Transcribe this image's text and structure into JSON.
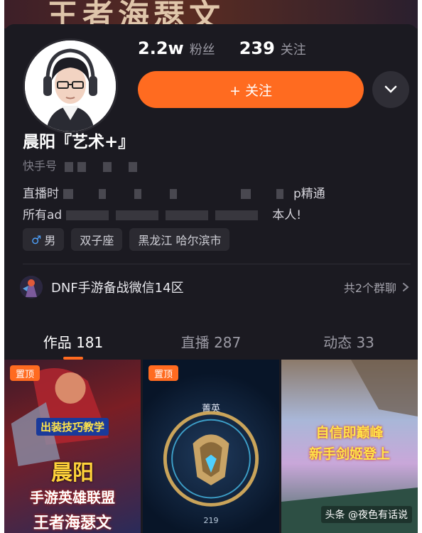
{
  "banner": {
    "text": "王者海瑟文"
  },
  "profile": {
    "fans_count": "2.2w",
    "fans_label": "粉丝",
    "following_count": "239",
    "following_label": "关注",
    "follow_button": "+ 关注",
    "name": "晨阳『艺术+』",
    "kuaishou_id_label": "快手号",
    "bio_line1": "直播时",
    "bio_line1_end": "p精通",
    "bio_line2_start": "所有ad",
    "bio_line2_end": "本人!",
    "tags": [
      {
        "label": "男",
        "icon": "male-icon"
      },
      {
        "label": "双子座"
      },
      {
        "label": "黑龙江 哈尔滨市"
      }
    ]
  },
  "group": {
    "name": "DNF手游备战微信14区",
    "count": "共2个群聊"
  },
  "tabs": [
    {
      "label": "作品",
      "count": "181",
      "active": true
    },
    {
      "label": "直播",
      "count": "287",
      "active": false
    },
    {
      "label": "动态",
      "count": "33",
      "active": false
    }
  ],
  "videos": [
    {
      "pinned": "置顶",
      "line1": "出装技巧教学",
      "line2": "晨阳",
      "line3": "手游英雄联盟",
      "line4": "王者海瑟文"
    },
    {
      "pinned": "置顶",
      "rank_name": "菁英",
      "rank_points": "219"
    },
    {
      "line1": "自信即巅峰",
      "line2": "新手剑姬登上"
    }
  ],
  "watermark": "头条 @夜色有话说",
  "colors": {
    "accent": "#ff6b20",
    "background": "#1b1a21"
  }
}
